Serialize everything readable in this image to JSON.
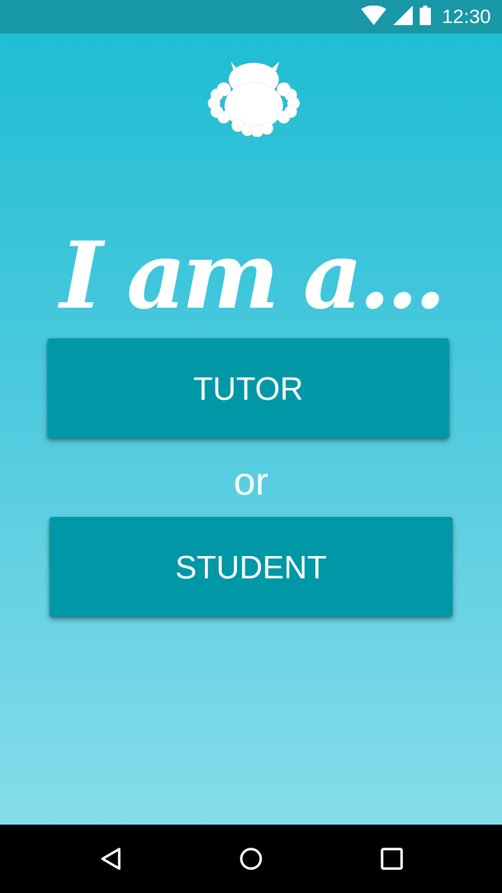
{
  "status_bar": {
    "time": "12:30",
    "icons": [
      "wifi-icon",
      "signal-icon",
      "battery-icon"
    ]
  },
  "logo": {
    "icon": "owl-icon"
  },
  "heading": "I am a...",
  "buttons": {
    "tutor_label": "TUTOR",
    "student_label": "STUDENT"
  },
  "separator_text": "or",
  "nav_bar": {
    "icons": [
      "back-icon",
      "home-icon",
      "recents-icon"
    ]
  },
  "colors": {
    "status_bar": "#1897a6",
    "gradient_top": "#1fbdd3",
    "gradient_bottom": "#86dde9",
    "button": "#0098a7",
    "text": "#ffffff",
    "nav_bar": "#000000"
  }
}
